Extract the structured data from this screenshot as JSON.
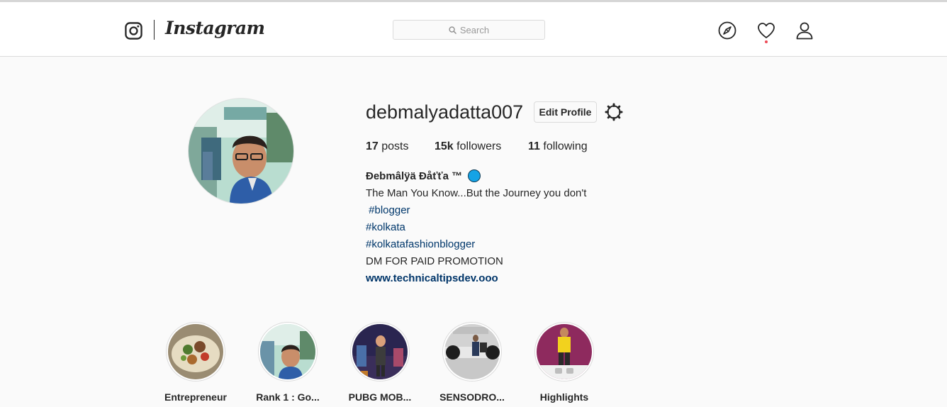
{
  "nav": {
    "brand": "Instagram",
    "search_placeholder": "Search",
    "icons": [
      "instagram-camera-icon",
      "explore-compass-icon",
      "activity-heart-icon",
      "profile-user-icon"
    ]
  },
  "profile": {
    "username": "debmalyadatta007",
    "edit_label": "Edit Profile",
    "posts_count": "17",
    "posts_label": "posts",
    "followers_count": "15k",
    "followers_label": "followers",
    "following_count": "11",
    "following_label": "following"
  },
  "bio": {
    "name": "Ðebmâlÿä Ðåťťa ™",
    "line1": "The Man You Know...But the Journey you don't",
    "tag1": " #blogger",
    "tag2": "#kolkata",
    "tag3": "#kolkatafashionblogger",
    "line2": "DM FOR PAID PROMOTION",
    "website": "www.technicaltipsdev.ooo"
  },
  "highlights": [
    {
      "label": "Entrepreneur"
    },
    {
      "label": "Rank 1 : Go..."
    },
    {
      "label": "PUBG MOB..."
    },
    {
      "label": "SENSODRO..."
    },
    {
      "label": "Highlights"
    }
  ],
  "colors": {
    "background": "#fafafa",
    "link": "#00376b",
    "notification": "#ed4956",
    "bio_badge": "#15a3e6"
  }
}
